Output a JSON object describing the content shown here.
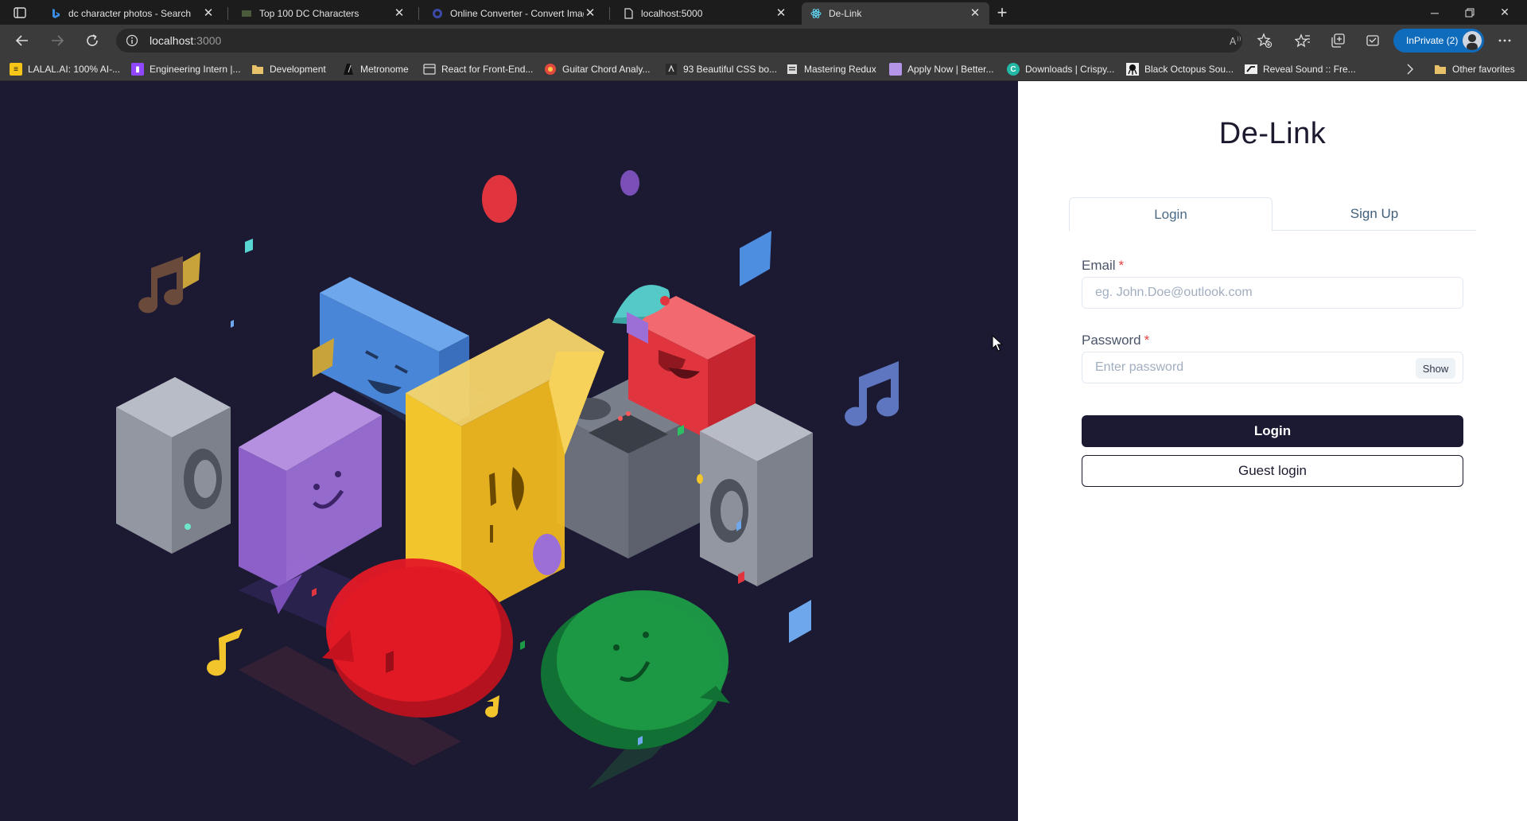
{
  "browser": {
    "tabs": [
      {
        "label": "dc character photos - Search",
        "favicon": "bing-icon",
        "active": false
      },
      {
        "label": "Top 100 DC Characters",
        "favicon": "page-icon",
        "active": false
      },
      {
        "label": "Online Converter - Convert Imag",
        "favicon": "converter-icon",
        "active": false
      },
      {
        "label": "localhost:5000",
        "favicon": "document-icon",
        "active": false
      },
      {
        "label": "De-Link",
        "favicon": "react-icon",
        "active": true
      }
    ],
    "url_host": "localhost",
    "url_port": ":3000",
    "inprivate_label": "InPrivate (2)",
    "favorites": [
      {
        "label": "LALAL.AI: 100% AI-...",
        "icon": "lalal-icon",
        "color": "#f5c518"
      },
      {
        "label": "Engineering Intern |...",
        "icon": "twitch-icon",
        "color": "#9146ff"
      },
      {
        "label": "Development",
        "icon": "folder-icon",
        "color": "#e8c26a"
      },
      {
        "label": "Metronome",
        "icon": "metronome-icon",
        "color": "#222222"
      },
      {
        "label": "React for Front-End...",
        "icon": "bookmark-icon",
        "color": "#555555"
      },
      {
        "label": "Guitar Chord Analy...",
        "icon": "chord-icon",
        "color": "#e2483d"
      },
      {
        "label": "93 Beautiful CSS bo...",
        "icon": "css-icon",
        "color": "#2b2b2b"
      },
      {
        "label": "Mastering Redux",
        "icon": "page-icon",
        "color": "#dddddd"
      },
      {
        "label": "Apply Now | Better...",
        "icon": "apply-icon",
        "color": "#b494e6"
      },
      {
        "label": "Downloads | Crispy...",
        "icon": "crispy-icon",
        "color": "#21b8a6"
      },
      {
        "label": "Black Octopus Sou...",
        "icon": "octopus-icon",
        "color": "#eeeeee"
      },
      {
        "label": "Reveal Sound :: Fre...",
        "icon": "reveal-icon",
        "color": "#eeeeee"
      }
    ],
    "other_favorites": "Other favorites"
  },
  "app": {
    "brand": "De-Link",
    "tabs": [
      "Login",
      "Sign Up"
    ],
    "active_tab": "Login",
    "email_label": "Email",
    "email_placeholder": "eg. John.Doe@outlook.com",
    "password_label": "Password",
    "password_placeholder": "Enter password",
    "required_mark": "*",
    "show_label": "Show",
    "login_label": "Login",
    "guest_label": "Guest login"
  },
  "colors": {
    "art_background": "#1c1a33",
    "primary_button": "#1c1a33",
    "required": "#e53e3e",
    "inprivate": "#0f6cbd"
  }
}
